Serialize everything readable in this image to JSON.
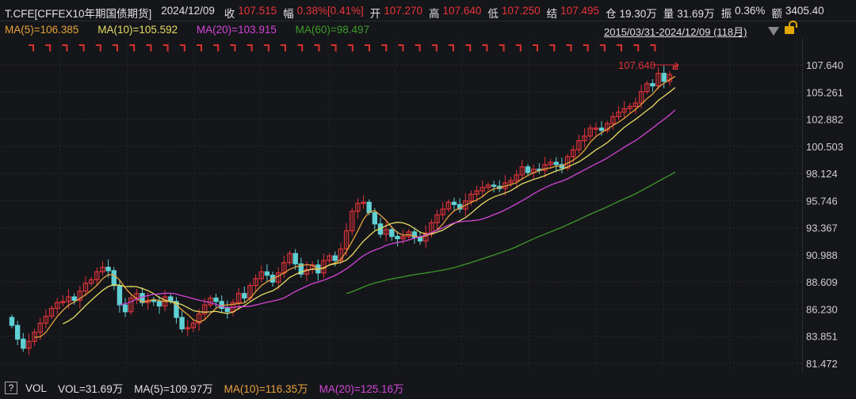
{
  "header": {
    "symbol": "T.CFE[CFFEX10年期国债期货]",
    "date": "2024/12/09",
    "close_label": "收",
    "close": "107.515",
    "change_label": "幅",
    "change": "0.38%[0.41%]",
    "open_label": "开",
    "open": "107.270",
    "high_label": "高",
    "high": "107.640",
    "low_label": "低",
    "low": "107.250",
    "settle_label": "结",
    "settle": "107.495",
    "oi_label": "仓",
    "oi": "19.30万",
    "volume_label": "量",
    "volume": "31.69万",
    "amplitude_label": "振",
    "amplitude": "0.36%",
    "amount_label": "额",
    "amount": "3405.40"
  },
  "ma_legend": {
    "ma5": "MA(5)=106.385",
    "ma10": "MA(10)=105.592",
    "ma20": "MA(20)=103.915",
    "ma60": "MA(60)=98.497"
  },
  "range": "2015/03/31-2024/12/09 (118月)",
  "volume_bar": {
    "help": "?",
    "label": "VOL",
    "vol": "VOL=31.69万",
    "ma5": "MA(5)=109.97万",
    "ma10": "MA(10)=116.35万",
    "ma20": "MA(20)=125.16万"
  },
  "colors": {
    "up": "#e0333a",
    "down": "#5fd0d4",
    "ma5": "#e9a23b",
    "ma10": "#e6dc62",
    "ma20": "#d445d8",
    "ma60": "#3d9a2a"
  },
  "chart_data": {
    "type": "candlestick",
    "period": "monthly",
    "ylim": [
      81.472,
      107.64
    ],
    "yticks": [
      "107.640",
      "105.261",
      "102.882",
      "100.503",
      "98.124",
      "95.746",
      "93.367",
      "90.988",
      "88.609",
      "86.230",
      "83.851",
      "81.472"
    ],
    "max_label": "107.640",
    "first_open": 85.5,
    "last_candle": {
      "open": 107.27,
      "high": 107.64,
      "low": 107.25,
      "close": 107.515
    },
    "closes": [
      84.8,
      83.6,
      82.8,
      83.4,
      84.2,
      85.0,
      85.6,
      86.3,
      86.8,
      86.9,
      87.3,
      87.0,
      87.8,
      88.5,
      88.8,
      89.5,
      89.9,
      89.6,
      88.3,
      86.6,
      86.0,
      87.2,
      87.6,
      86.8,
      87.0,
      86.9,
      86.5,
      87.3,
      86.9,
      85.5,
      84.5,
      84.6,
      85.0,
      85.8,
      86.6,
      87.2,
      86.9,
      86.3,
      86.0,
      86.8,
      87.6,
      87.2,
      88.3,
      88.9,
      89.5,
      89.2,
      88.6,
      89.4,
      90.3,
      91.1,
      90.2,
      89.3,
      89.7,
      90.1,
      89.4,
      90.5,
      90.9,
      90.5,
      91.5,
      93.1,
      94.8,
      95.5,
      95.6,
      94.7,
      93.7,
      92.8,
      93.2,
      92.6,
      92.4,
      92.6,
      93.0,
      92.5,
      92.2,
      92.9,
      93.8,
      94.5,
      95.0,
      95.6,
      95.4,
      95.0,
      95.7,
      96.3,
      96.6,
      96.9,
      97.1,
      97.0,
      96.8,
      97.3,
      97.5,
      98.0,
      98.7,
      98.2,
      98.5,
      98.4,
      98.9,
      99.1,
      98.9,
      98.6,
      99.6,
      100.2,
      101.0,
      101.4,
      102.1,
      102.1,
      101.9,
      102.5,
      103.1,
      103.5,
      103.8,
      104.0,
      104.3,
      105.3,
      106.0,
      105.8,
      106.9,
      106.2,
      106.8,
      107.515
    ],
    "moving_averages": [
      5,
      10,
      20,
      60
    ]
  }
}
